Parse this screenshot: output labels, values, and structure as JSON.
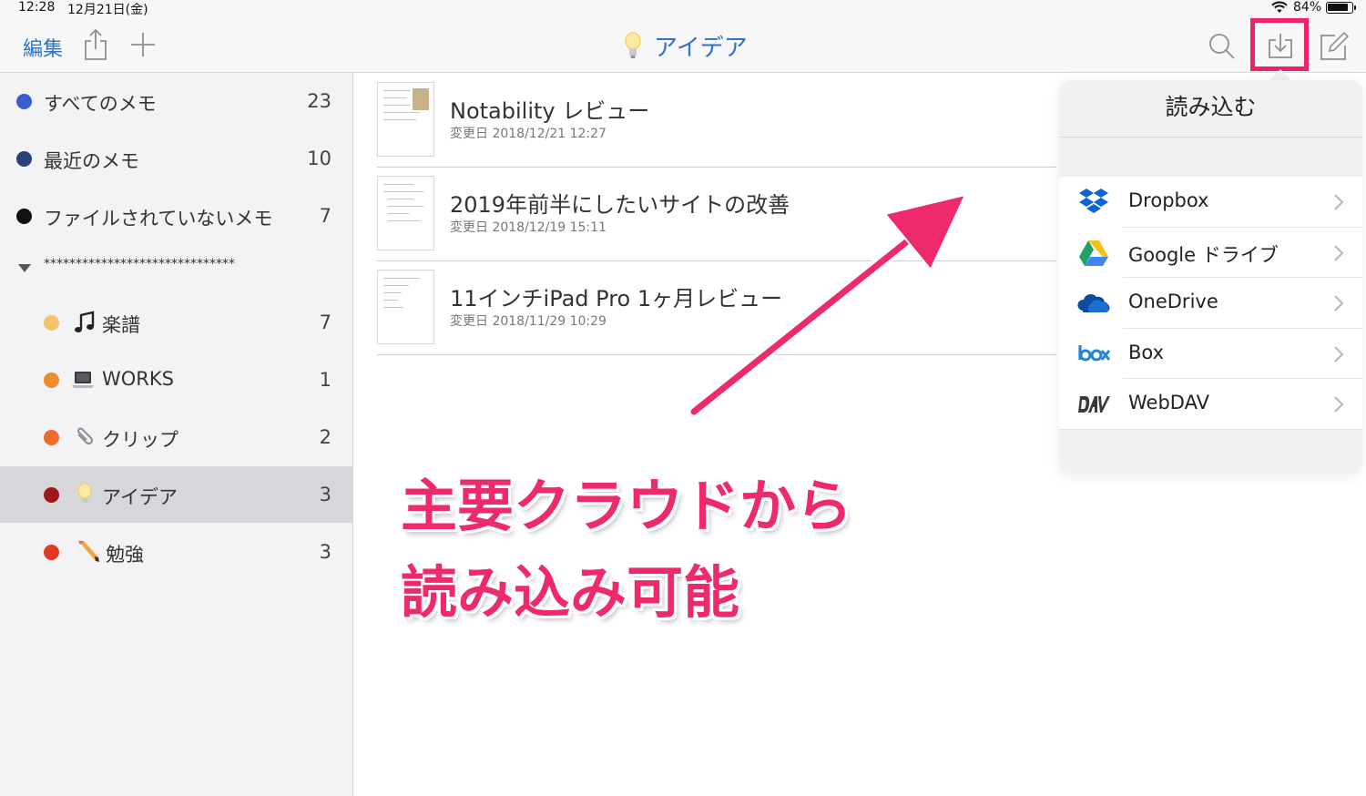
{
  "status_bar": {
    "time": "12:28",
    "date": "12月21日(金)",
    "battery": "84%"
  },
  "nav": {
    "edit_label": "編集",
    "title": "アイデア",
    "accent_color": "#2f72c9",
    "highlight_color": "#f0206a"
  },
  "sidebar": {
    "items": [
      {
        "label": "すべてのメモ",
        "count": "23",
        "dot_color": "#3a5fcd"
      },
      {
        "label": "最近のメモ",
        "count": "10",
        "dot_color": "#28427a"
      },
      {
        "label": "ファイルされていないメモ",
        "count": "7",
        "dot_color": "#111111"
      }
    ],
    "group_label": "******************************",
    "sub_items": [
      {
        "label": "楽譜",
        "count": "7",
        "dot_color": "#f2c56a",
        "icon": "music-note-icon"
      },
      {
        "label": "WORKS",
        "count": "1",
        "dot_color": "#ee8a2f",
        "icon": "laptop-icon"
      },
      {
        "label": "クリップ",
        "count": "2",
        "dot_color": "#ee6a2f",
        "icon": "paperclip-icon"
      },
      {
        "label": "アイデア",
        "count": "3",
        "dot_color": "#a01818",
        "icon": "lightbulb-icon"
      },
      {
        "label": "勉強",
        "count": "3",
        "dot_color": "#e23a20",
        "icon": "pencil-icon"
      }
    ]
  },
  "notes": [
    {
      "title": "Notability レビュー",
      "date": "変更日 2018/12/21 12:27"
    },
    {
      "title": "2019年前半にしたいサイトの改善",
      "date": "変更日 2018/12/19 15:11"
    },
    {
      "title": "11インチiPad Pro 1ヶ月レビュー",
      "date": "変更日 2018/11/29 10:29"
    }
  ],
  "popover": {
    "title": "読み込む",
    "items": [
      {
        "label": "Dropbox",
        "icon": "dropbox-icon"
      },
      {
        "label": "Google ドライブ",
        "icon": "google-drive-icon"
      },
      {
        "label": "OneDrive",
        "icon": "onedrive-icon"
      },
      {
        "label": "Box",
        "icon": "box-icon"
      },
      {
        "label": "WebDAV",
        "icon": "webdav-icon"
      }
    ]
  },
  "annotation": {
    "line1": "主要クラウドから",
    "line2": "読み込み可能",
    "color": "#ee2a6b"
  }
}
